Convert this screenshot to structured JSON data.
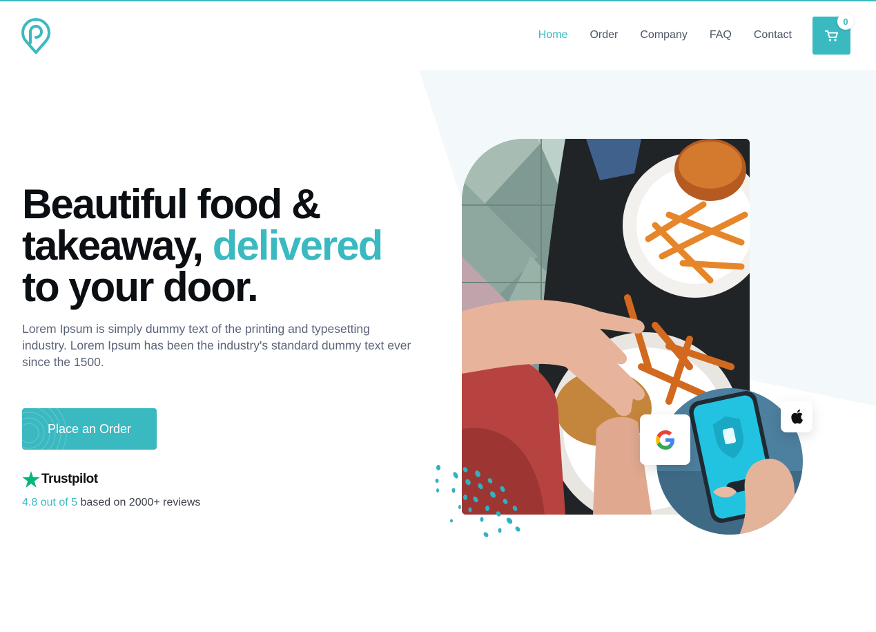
{
  "header": {
    "logo_icon": "location-pin-logo-icon",
    "nav": [
      {
        "label": "Home",
        "active": true
      },
      {
        "label": "Order",
        "active": false
      },
      {
        "label": "Company",
        "active": false
      },
      {
        "label": "FAQ",
        "active": false
      },
      {
        "label": "Contact",
        "active": false
      }
    ],
    "cart": {
      "icon": "cart-icon",
      "count": "0"
    }
  },
  "hero": {
    "headline_line1": "Beautiful food &",
    "headline_line2_start": "takeaway,",
    "headline_line2_accent": "delivered",
    "headline_line3": "to your door.",
    "description": "Lorem Ipsum is simply dummy text of the printing and typesetting industry. Lorem Ipsum has been the industry's standard dummy text ever since the 1500.",
    "cta_label": "Place an Order",
    "trustpilot": {
      "brand": "Trustpilot",
      "rating_highlight": "4.8 out of 5",
      "rating_rest": "based on 2000+ reviews"
    }
  },
  "media": {
    "food_image": "food-photo",
    "phone_image": "phone-app-photo",
    "store_badges": [
      "google-icon",
      "apple-icon"
    ]
  },
  "colors": {
    "accent": "#3bb9c1",
    "headline": "#0b0f14",
    "body_text": "#5a6478",
    "trustpilot_green": "#00b67a"
  }
}
